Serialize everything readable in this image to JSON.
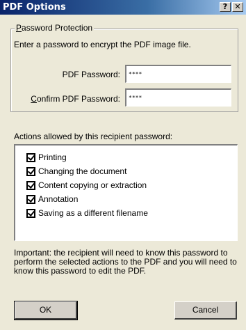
{
  "window": {
    "title": "PDF Options",
    "help_label": "?",
    "close_label": "✕"
  },
  "protection": {
    "legend_first": "P",
    "legend_rest": "assword Protection",
    "instructions": "Enter a password to encrypt the PDF image file.",
    "password_label": "PDF Password:",
    "password_value": "****",
    "confirm_label_first": "C",
    "confirm_label_rest": "onfirm PDF Password:",
    "confirm_value": "****"
  },
  "actions": {
    "label": "Actions allowed by this recipient password:",
    "items": [
      {
        "label": "Printing",
        "checked": true
      },
      {
        "label": "Changing the document",
        "checked": true
      },
      {
        "label": "Content copying or extraction",
        "checked": true
      },
      {
        "label": "Annotation",
        "checked": true
      },
      {
        "label": "Saving as a different filename",
        "checked": true
      }
    ]
  },
  "note": "Important:  the recipient will need to know this password to perform the selected actions to the PDF and you will need to know this password to edit the PDF.",
  "buttons": {
    "ok": "OK",
    "cancel": "Cancel"
  }
}
